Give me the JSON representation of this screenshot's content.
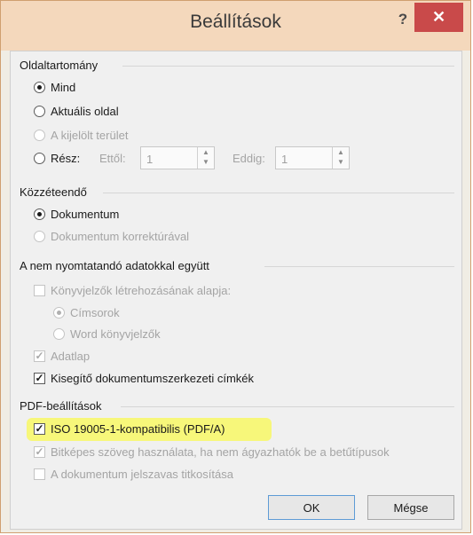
{
  "dialog": {
    "title": "Beállítások",
    "help_label": "?",
    "close_label": "✕"
  },
  "page_range": {
    "title": "Oldaltartomány",
    "options": [
      "Mind",
      "Aktuális oldal",
      "A kijelölt terület",
      "Rész:"
    ],
    "selected": "Mind",
    "from_label": "Ettől:",
    "from_value": "1",
    "to_label": "Eddig:",
    "to_value": "1"
  },
  "publish": {
    "title": "Közzéteendő",
    "options": [
      "Dokumentum",
      "Dokumentum korrektúrával"
    ],
    "selected": "Dokumentum"
  },
  "non_printing": {
    "title": "A nem nyomtatandó adatokkal együtt",
    "bookmarks_label": "Könyvjelzők létrehozásának alapja:",
    "headings_label": "Címsorok",
    "word_bookmarks_label": "Word könyvjelzők",
    "properties_label": "Adatlap",
    "structure_tags_label": "Kisegítő dokumentumszerkezeti címkék"
  },
  "pdf": {
    "title": "PDF-beállítások",
    "iso_label": "ISO 19005-1-kompatibilis (PDF/A)",
    "bitmap_text_label": "Bitképes szöveg használata, ha nem ágyazhatók be a betűtípusok",
    "encrypt_label": "A dokumentum jelszavas titkosítása"
  },
  "buttons": {
    "ok": "OK",
    "cancel": "Mégse"
  },
  "colors": {
    "title_bar": "#f4d8bc",
    "close_button": "#c94a4a",
    "highlight": "#f7f77a"
  }
}
